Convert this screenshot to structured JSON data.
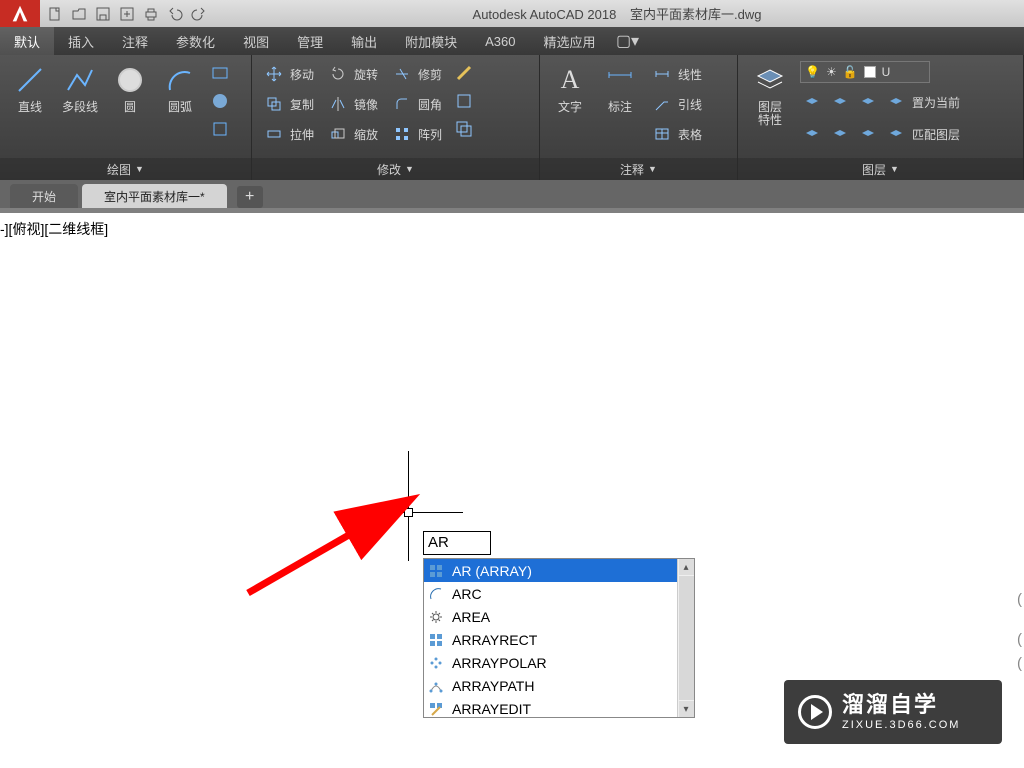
{
  "title": {
    "app": "Autodesk AutoCAD 2018",
    "file": "室内平面素材库一.dwg"
  },
  "menu": {
    "tabs": [
      "默认",
      "插入",
      "注释",
      "参数化",
      "视图",
      "管理",
      "输出",
      "附加模块",
      "A360",
      "精选应用"
    ],
    "active": 0
  },
  "panels": {
    "draw": {
      "title": "绘图",
      "btns": [
        "直线",
        "多段线",
        "圆",
        "圆弧"
      ]
    },
    "modify": {
      "title": "修改",
      "rows1": [
        "移动",
        "复制",
        "拉伸"
      ],
      "rows2": [
        "旋转",
        "镜像",
        "缩放"
      ],
      "rows3": [
        "修剪",
        "圆角",
        "阵列"
      ]
    },
    "annot": {
      "title": "注释",
      "btns": [
        "文字",
        "标注"
      ],
      "side": [
        "线性",
        "引线",
        "表格"
      ]
    },
    "layers": {
      "title": "图层",
      "btn": "图层\n特性",
      "current": "U",
      "right1": "置为当前",
      "right2": "匹配图层"
    }
  },
  "doctabs": {
    "inactive": "开始",
    "active": "室内平面素材库一*"
  },
  "viewport": {
    "label": "-][俯视][二维线框]"
  },
  "command": {
    "input": "AR"
  },
  "autocomplete": {
    "items": [
      "AR (ARRAY)",
      "ARC",
      "AREA",
      "ARRAYRECT",
      "ARRAYPOLAR",
      "ARRAYPATH",
      "ARRAYEDIT"
    ],
    "selected": 0
  },
  "watermark": {
    "cn": "溜溜自学",
    "en": "ZIXUE.3D66.COM"
  }
}
